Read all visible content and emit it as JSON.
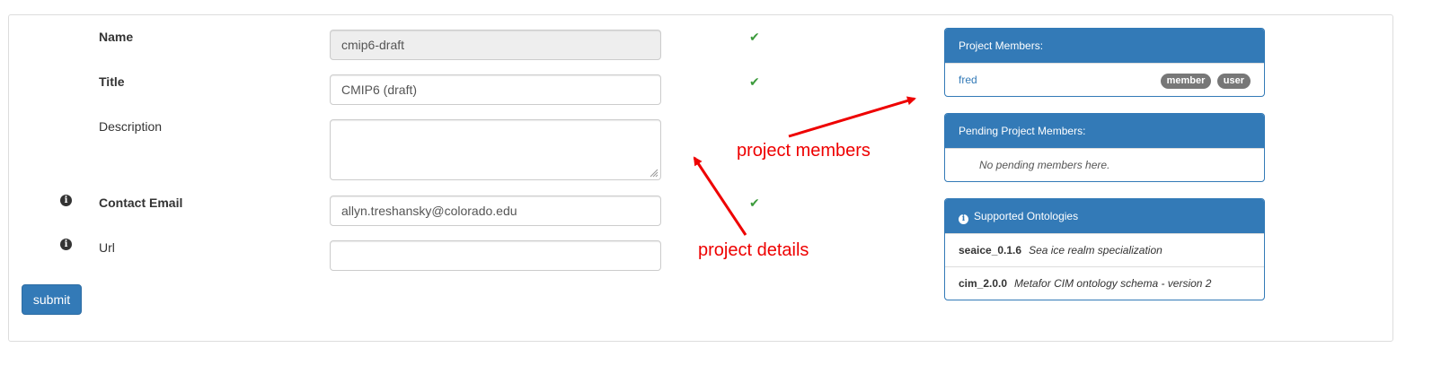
{
  "form": {
    "name": {
      "label": "Name",
      "value": "cmip6-draft"
    },
    "title": {
      "label": "Title",
      "value": "CMIP6 (draft)"
    },
    "description": {
      "label": "Description",
      "value": ""
    },
    "contact_email": {
      "label": "Contact Email",
      "value": "allyn.treshansky@colorado.edu"
    },
    "url": {
      "label": "Url",
      "value": ""
    },
    "checkmark": "✔",
    "submit_label": "submit"
  },
  "members_panel": {
    "heading": "Project Members:",
    "members": [
      {
        "name": "fred",
        "badges": [
          "member",
          "user"
        ]
      }
    ]
  },
  "pending_panel": {
    "heading": "Pending Project Members:",
    "empty_message": "No pending members here."
  },
  "ontologies_panel": {
    "heading": "Supported Ontologies",
    "items": [
      {
        "name": "seaice_0.1.6",
        "description": "Sea ice realm specialization"
      },
      {
        "name": "cim_2.0.0",
        "description": "Metafor CIM ontology schema - version 2"
      }
    ]
  },
  "annotations": {
    "project_members": "project members",
    "project_details": "project details",
    "color": "#e00000"
  },
  "colors": {
    "primary": "#337ab7",
    "badge": "#777777",
    "check": "#3c9b3c"
  }
}
